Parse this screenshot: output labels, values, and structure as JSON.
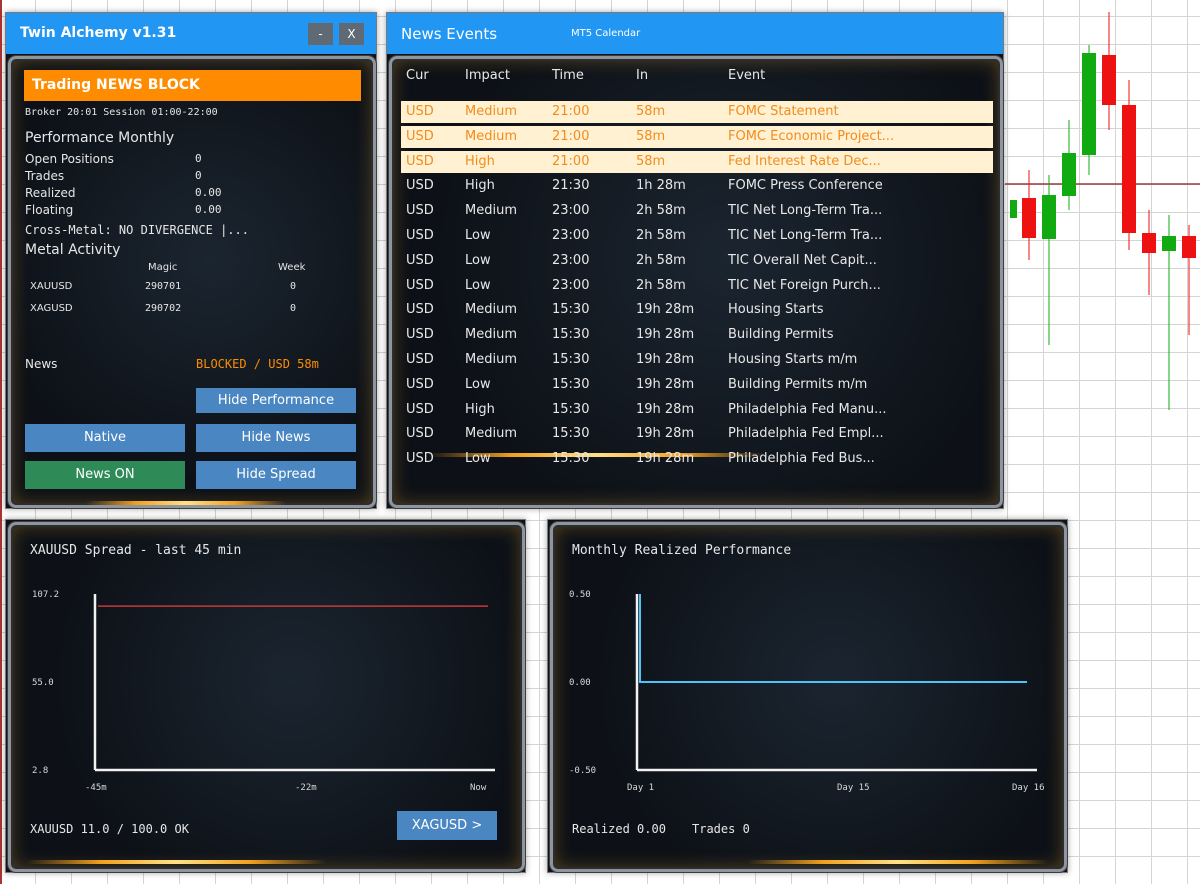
{
  "left_window": {
    "title": "Twin Alchemy v1.31",
    "minimize_label": "-",
    "close_label": "X",
    "banner": "Trading NEWS BLOCK",
    "broker_line": "Broker 20:01  Session 01:00-22:00",
    "perf_heading": "Performance Monthly",
    "stats": [
      {
        "label": "Open Positions",
        "value": "0"
      },
      {
        "label": "Trades",
        "value": "0"
      },
      {
        "label": "Realized",
        "value": "0.00"
      },
      {
        "label": "Floating",
        "value": "0.00"
      }
    ],
    "cross_metal": "Cross-Metal: NO DIVERGENCE |...",
    "metal_heading": "Metal Activity",
    "metal_cols": {
      "magic": "Magic",
      "week": "Week"
    },
    "metals": [
      {
        "symbol": "XAUUSD",
        "magic": "290701",
        "week": "0"
      },
      {
        "symbol": "XAGUSD",
        "magic": "290702",
        "week": "0"
      }
    ],
    "news_label": "News",
    "news_status": "BLOCKED / USD 58m",
    "buttons": {
      "hide_performance": "Hide Performance",
      "native": "Native",
      "hide_news": "Hide News",
      "news_on": "News ON",
      "hide_spread": "Hide Spread"
    }
  },
  "news_window": {
    "title": "News Events",
    "subtitle": "MT5 Calendar",
    "columns": {
      "cur": "Cur",
      "impact": "Impact",
      "time": "Time",
      "in": "In",
      "event": "Event"
    },
    "rows": [
      {
        "cur": "USD",
        "impact": "Medium",
        "time": "21:00",
        "in": "58m",
        "event": "FOMC Statement",
        "hl": true
      },
      {
        "cur": "USD",
        "impact": "Medium",
        "time": "21:00",
        "in": "58m",
        "event": "FOMC Economic Project...",
        "hl": true
      },
      {
        "cur": "USD",
        "impact": "High",
        "time": "21:00",
        "in": "58m",
        "event": "Fed Interest Rate Dec...",
        "hl": true
      },
      {
        "cur": "USD",
        "impact": "High",
        "time": "21:30",
        "in": "1h 28m",
        "event": "FOMC Press Conference",
        "hl": false
      },
      {
        "cur": "USD",
        "impact": "Medium",
        "time": "23:00",
        "in": "2h 58m",
        "event": "TIC Net Long-Term Tra...",
        "hl": false
      },
      {
        "cur": "USD",
        "impact": "Low",
        "time": "23:00",
        "in": "2h 58m",
        "event": "TIC Net Long-Term Tra...",
        "hl": false
      },
      {
        "cur": "USD",
        "impact": "Low",
        "time": "23:00",
        "in": "2h 58m",
        "event": "TIC Overall Net Capit...",
        "hl": false
      },
      {
        "cur": "USD",
        "impact": "Low",
        "time": "23:00",
        "in": "2h 58m",
        "event": "TIC Net Foreign Purch...",
        "hl": false
      },
      {
        "cur": "USD",
        "impact": "Medium",
        "time": "15:30",
        "in": "19h 28m",
        "event": "Housing Starts",
        "hl": false
      },
      {
        "cur": "USD",
        "impact": "Medium",
        "time": "15:30",
        "in": "19h 28m",
        "event": "Building Permits",
        "hl": false
      },
      {
        "cur": "USD",
        "impact": "Medium",
        "time": "15:30",
        "in": "19h 28m",
        "event": "Housing Starts m/m",
        "hl": false
      },
      {
        "cur": "USD",
        "impact": "Low",
        "time": "15:30",
        "in": "19h 28m",
        "event": "Building Permits m/m",
        "hl": false
      },
      {
        "cur": "USD",
        "impact": "High",
        "time": "15:30",
        "in": "19h 28m",
        "event": "Philadelphia Fed Manu...",
        "hl": false
      },
      {
        "cur": "USD",
        "impact": "Medium",
        "time": "15:30",
        "in": "19h 28m",
        "event": "Philadelphia Fed Empl...",
        "hl": false
      },
      {
        "cur": "USD",
        "impact": "Low",
        "time": "15:30",
        "in": "19h 28m",
        "event": "Philadelphia Fed Bus...",
        "hl": false
      }
    ]
  },
  "spread_panel": {
    "bottom_status": "XAUUSD  11.0 / 100.0 OK",
    "switch_button": "XAGUSD >"
  },
  "perf_panel": {
    "bottom_realized": "Realized 0.00",
    "bottom_trades": "Trades 0"
  },
  "chart_data": [
    {
      "type": "line",
      "title": "XAUUSD Spread - last 45 min",
      "xlabel": "",
      "ylabel": "",
      "ylim": [
        2.8,
        107.2
      ],
      "y_ticks": [
        "107.2",
        "55.0",
        "2.8"
      ],
      "x_ticks": [
        "-45m",
        "-22m",
        "Now"
      ],
      "series": [
        {
          "values": [
            100,
            100
          ]
        }
      ],
      "series_color": "#c83838"
    },
    {
      "type": "line",
      "title": "Monthly Realized Performance",
      "xlabel": "",
      "ylabel": "",
      "ylim": [
        -0.5,
        0.5
      ],
      "y_ticks": [
        "0.50",
        "0.00",
        "-0.50"
      ],
      "x_ticks": [
        "Day 1",
        "Day 15",
        "Day 16"
      ],
      "series": [
        {
          "values": [
            0.5,
            0.0,
            0.0
          ]
        }
      ],
      "series_color": "#4fc3f7"
    }
  ],
  "colors": {
    "accent_blue": "#2196f3",
    "banner_orange": "#ff8c00",
    "button_blue": "#4a86c1",
    "button_green": "#2e8b57",
    "highlight_row": "#fff1d2",
    "candle_green": "#11a611",
    "candle_red": "#ee1111"
  }
}
